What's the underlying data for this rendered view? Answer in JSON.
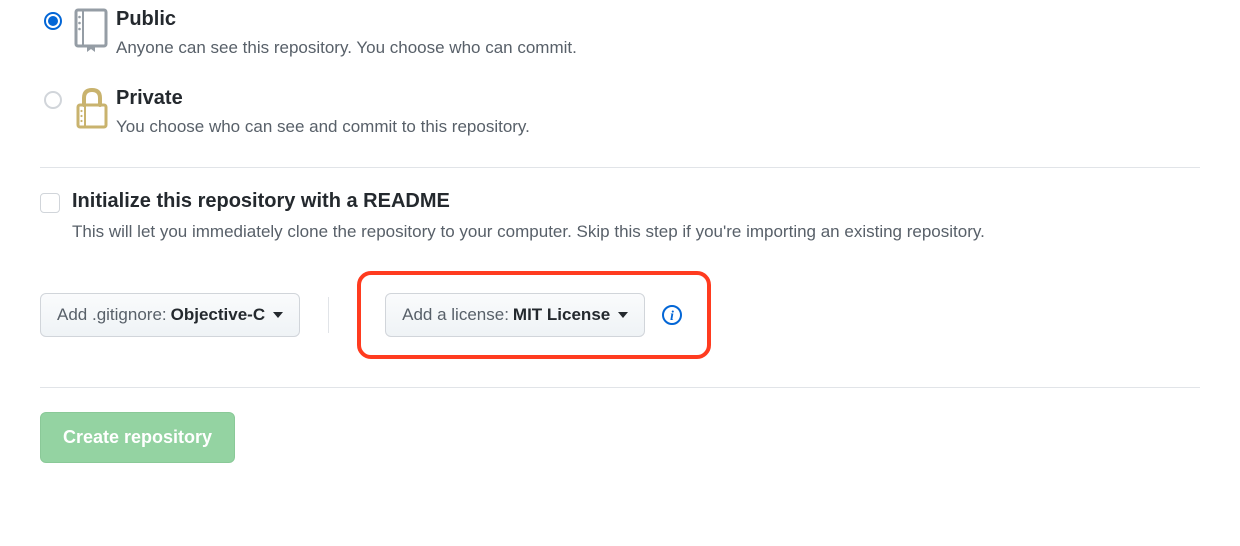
{
  "visibility": {
    "public": {
      "title": "Public",
      "desc": "Anyone can see this repository. You choose who can commit."
    },
    "private": {
      "title": "Private",
      "desc": "You choose who can see and commit to this repository."
    }
  },
  "readme": {
    "title": "Initialize this repository with a README",
    "desc": "This will let you immediately clone the repository to your computer. Skip this step if you're importing an existing repository."
  },
  "gitignore": {
    "label": "Add .gitignore:",
    "value": "Objective-C"
  },
  "license": {
    "label": "Add a license:",
    "value": "MIT License"
  },
  "submit": {
    "label": "Create repository"
  }
}
